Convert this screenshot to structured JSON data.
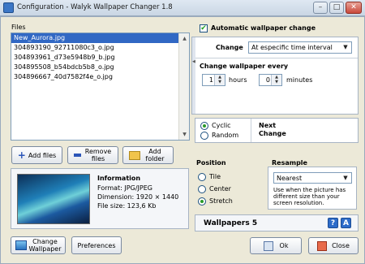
{
  "window": {
    "title": "Configuration - Walyk Wallpaper Changer 1.8",
    "minimize": "–",
    "maximize": "□",
    "close": "✕"
  },
  "files": {
    "header": "Files",
    "items": [
      "New_Aurora.jpg",
      "304893190_92711080c3_o.jpg",
      "304893961_d73e5948b9_b.jpg",
      "304895508_b54bdcb5b8_o.jpg",
      "304896667_40d7582f4e_o.jpg"
    ],
    "selected_index": 0,
    "scroll_up": "▲",
    "scroll_down": "▼",
    "add_label": "Add files",
    "remove_label": "Remove files",
    "add_folder_label": "Add folder"
  },
  "info": {
    "heading": "Information",
    "format": "Format: JPG/JPEG",
    "dimension": "Dimension: 1920 × 1440",
    "file_size": "File size: 123,6 Kb"
  },
  "auto_change": {
    "label": "Automatic wallpaper change",
    "checked": true,
    "check_glyph": "✔"
  },
  "change": {
    "label": "Change",
    "mode": "At especific time interval",
    "every_label": "Change wallpaper every",
    "hours_value": "1",
    "hours_label": "hours",
    "minutes_value": "0",
    "minutes_label": "minutes",
    "collapse_glyph": "◀"
  },
  "order": {
    "cyclic_label": "Cyclic",
    "random_label": "Random",
    "selected": "cyclic",
    "next_change_label": "Next Change"
  },
  "position": {
    "heading": "Position",
    "tile_label": "Tile",
    "center_label": "Center",
    "stretch_label": "Stretch",
    "selected": "stretch"
  },
  "resample": {
    "heading": "Resample",
    "value": "Nearest",
    "hint": "Use when the picture has different size than your screen resolution."
  },
  "wallpapers": {
    "label": "Wallpapers 5",
    "help_glyph": "?",
    "about_glyph": "A"
  },
  "bottom": {
    "change_wallpaper_label": "Change Wallpaper",
    "preferences_label": "Preferences",
    "ok_label": "Ok",
    "close_label": "Close"
  },
  "colors": {
    "selection": "#3168c4",
    "accent": "#3c77c6"
  }
}
